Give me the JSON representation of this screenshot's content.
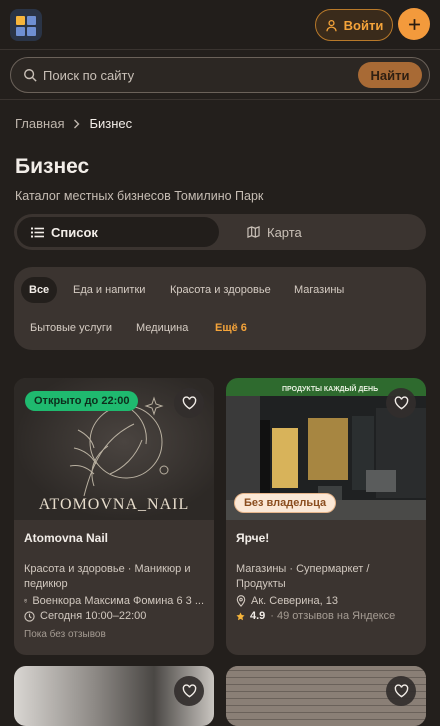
{
  "header": {
    "login_label": "Войти",
    "logo_colors": [
      "#f6b53c",
      "#6f8fd1",
      "#6f8fd1",
      "#6f8fd1"
    ],
    "add_icon": "plus-icon"
  },
  "search": {
    "placeholder": "Поиск по сайту",
    "button_label": "Найти"
  },
  "breadcrumb": {
    "home": "Главная",
    "separator": ">",
    "current": "Бизнес"
  },
  "page": {
    "title": "Бизнес",
    "subtitle": "Каталог местных бизнесов Томилино Парк"
  },
  "view_toggle": {
    "list_label": "Список",
    "map_label": "Карта",
    "active": "list"
  },
  "categories": [
    {
      "label": "Все",
      "selected": true
    },
    {
      "label": "Еда и напитки"
    },
    {
      "label": "Красота и здоровье"
    },
    {
      "label": "Магазины"
    },
    {
      "label": "Бытовые услуги"
    },
    {
      "label": "Медицина"
    },
    {
      "label": "Ещё 6",
      "more": true
    }
  ],
  "cards": [
    {
      "badge": "Открыто до 22:00",
      "image_text": "ATOMOVNA_NAIL",
      "name": "Atomovna Nail",
      "category": "Красота и здоровье · Маникюр и педикюр",
      "address": "Военкора Максима Фомина 6 3 ...",
      "hours": "Сегодня 10:00–22:00",
      "reviews": "Пока без отзывов"
    },
    {
      "badge": "Без владельца",
      "image_text": "ПРОДУКТЫ КАЖДЫЙ ДЕНЬ",
      "name": "Ярче!",
      "category": "Магазины · Супермаркет / Продукты",
      "address": "Ак. Северина, 13",
      "rating": "4.9",
      "reviews": "· 49 отзывов на Яндексе"
    }
  ],
  "colors": {
    "accent": "#f39a3c",
    "open_badge": "#1fba6f",
    "background": "#231f1c",
    "card": "#3b3430"
  }
}
